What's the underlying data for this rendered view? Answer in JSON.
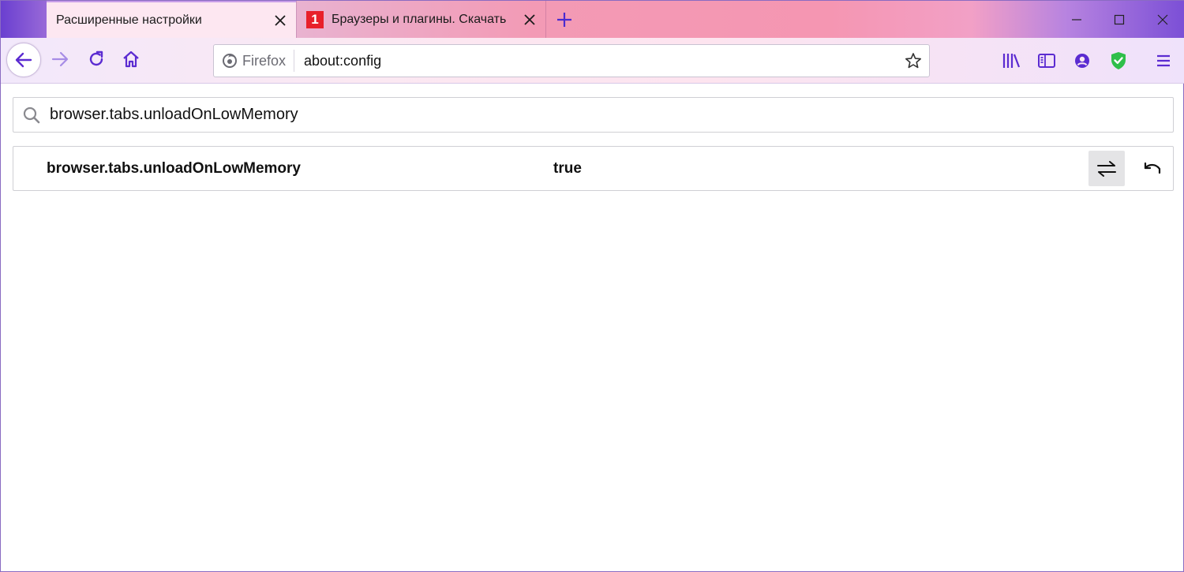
{
  "tabs": [
    {
      "title": "Расширенные настройки",
      "active": true
    },
    {
      "title": "Браузеры и плагины. Скачать",
      "active": false,
      "favicon_text": "1"
    }
  ],
  "navbar": {
    "identity_label": "Firefox",
    "url": "about:config"
  },
  "config": {
    "search_value": "browser.tabs.unloadOnLowMemory",
    "preference": {
      "name": "browser.tabs.unloadOnLowMemory",
      "value": "true"
    }
  },
  "colors": {
    "accent": "#5b2bd1",
    "shield": "#2fbf4a"
  },
  "icons": [
    "close-icon",
    "plus-icon",
    "minimize-icon",
    "maximize-icon",
    "back-icon",
    "forward-icon",
    "reload-icon",
    "home-icon",
    "firefox-icon",
    "star-icon",
    "library-icon",
    "sidebar-icon",
    "account-icon",
    "shield-icon",
    "menu-icon",
    "search-icon",
    "toggle-icon",
    "reset-icon"
  ]
}
